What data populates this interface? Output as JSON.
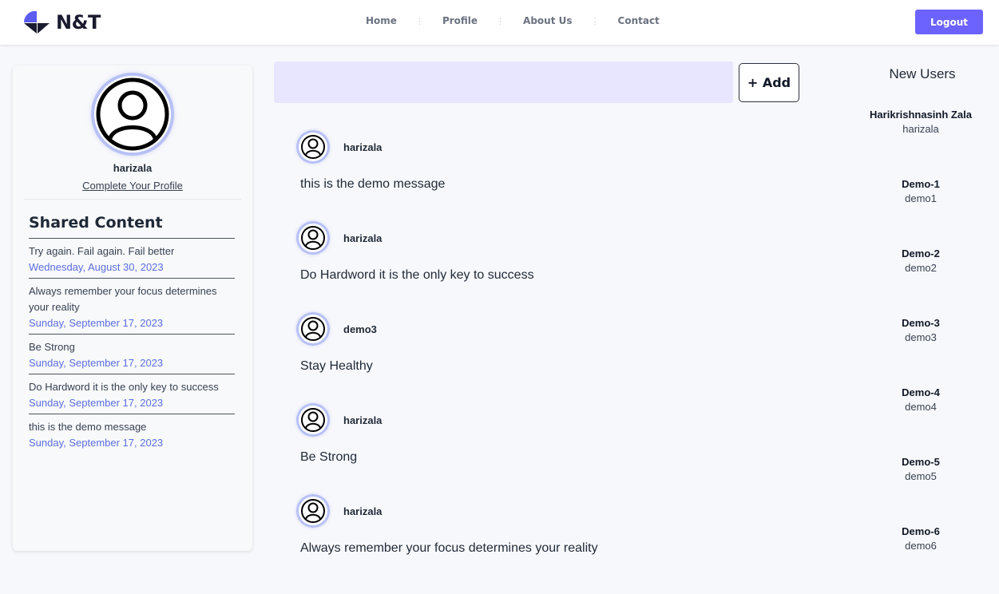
{
  "brand": {
    "name": "N&T",
    "accent": "#6c63ff",
    "link_color": "#5b6ee1"
  },
  "nav": {
    "items": [
      {
        "label": "Home"
      },
      {
        "label": "Profile"
      },
      {
        "label": "About Us"
      },
      {
        "label": "Contact"
      }
    ],
    "separator": "⋮",
    "logout_label": "Logout"
  },
  "profile": {
    "username": "harizala",
    "complete_link": "Complete Your Profile",
    "avatar_icon": "user-circle-icon"
  },
  "shared": {
    "title": "Shared Content",
    "items": [
      {
        "text": "Try again. Fail again. Fail better",
        "date": "Wednesday, August 30, 2023"
      },
      {
        "text": "Always remember your focus determines your reality",
        "date": "Sunday, September 17, 2023"
      },
      {
        "text": "Be Strong",
        "date": "Sunday, September 17, 2023"
      },
      {
        "text": "Do Hardword it is the only key to success",
        "date": "Sunday, September 17, 2023"
      },
      {
        "text": "this is the demo message",
        "date": "Sunday, September 17, 2023"
      }
    ]
  },
  "composer": {
    "placeholder": "",
    "add_label": "+ Add"
  },
  "feed": {
    "posts": [
      {
        "user": "harizala",
        "message": "this is the demo message"
      },
      {
        "user": "harizala",
        "message": "Do Hardword it is the only key to success"
      },
      {
        "user": "demo3",
        "message": "Stay Healthy"
      },
      {
        "user": "harizala",
        "message": "Be Strong"
      },
      {
        "user": "harizala",
        "message": "Always remember your focus determines your reality"
      }
    ]
  },
  "new_users": {
    "title": "New Users",
    "users": [
      {
        "name": "Harikrishnasinh Zala",
        "handle": "harizala"
      },
      {
        "name": "Demo-1",
        "handle": "demo1"
      },
      {
        "name": "Demo-2",
        "handle": "demo2"
      },
      {
        "name": "Demo-3",
        "handle": "demo3"
      },
      {
        "name": "Demo-4",
        "handle": "demo4"
      },
      {
        "name": "Demo-5",
        "handle": "demo5"
      },
      {
        "name": "Demo-6",
        "handle": "demo6"
      }
    ]
  }
}
